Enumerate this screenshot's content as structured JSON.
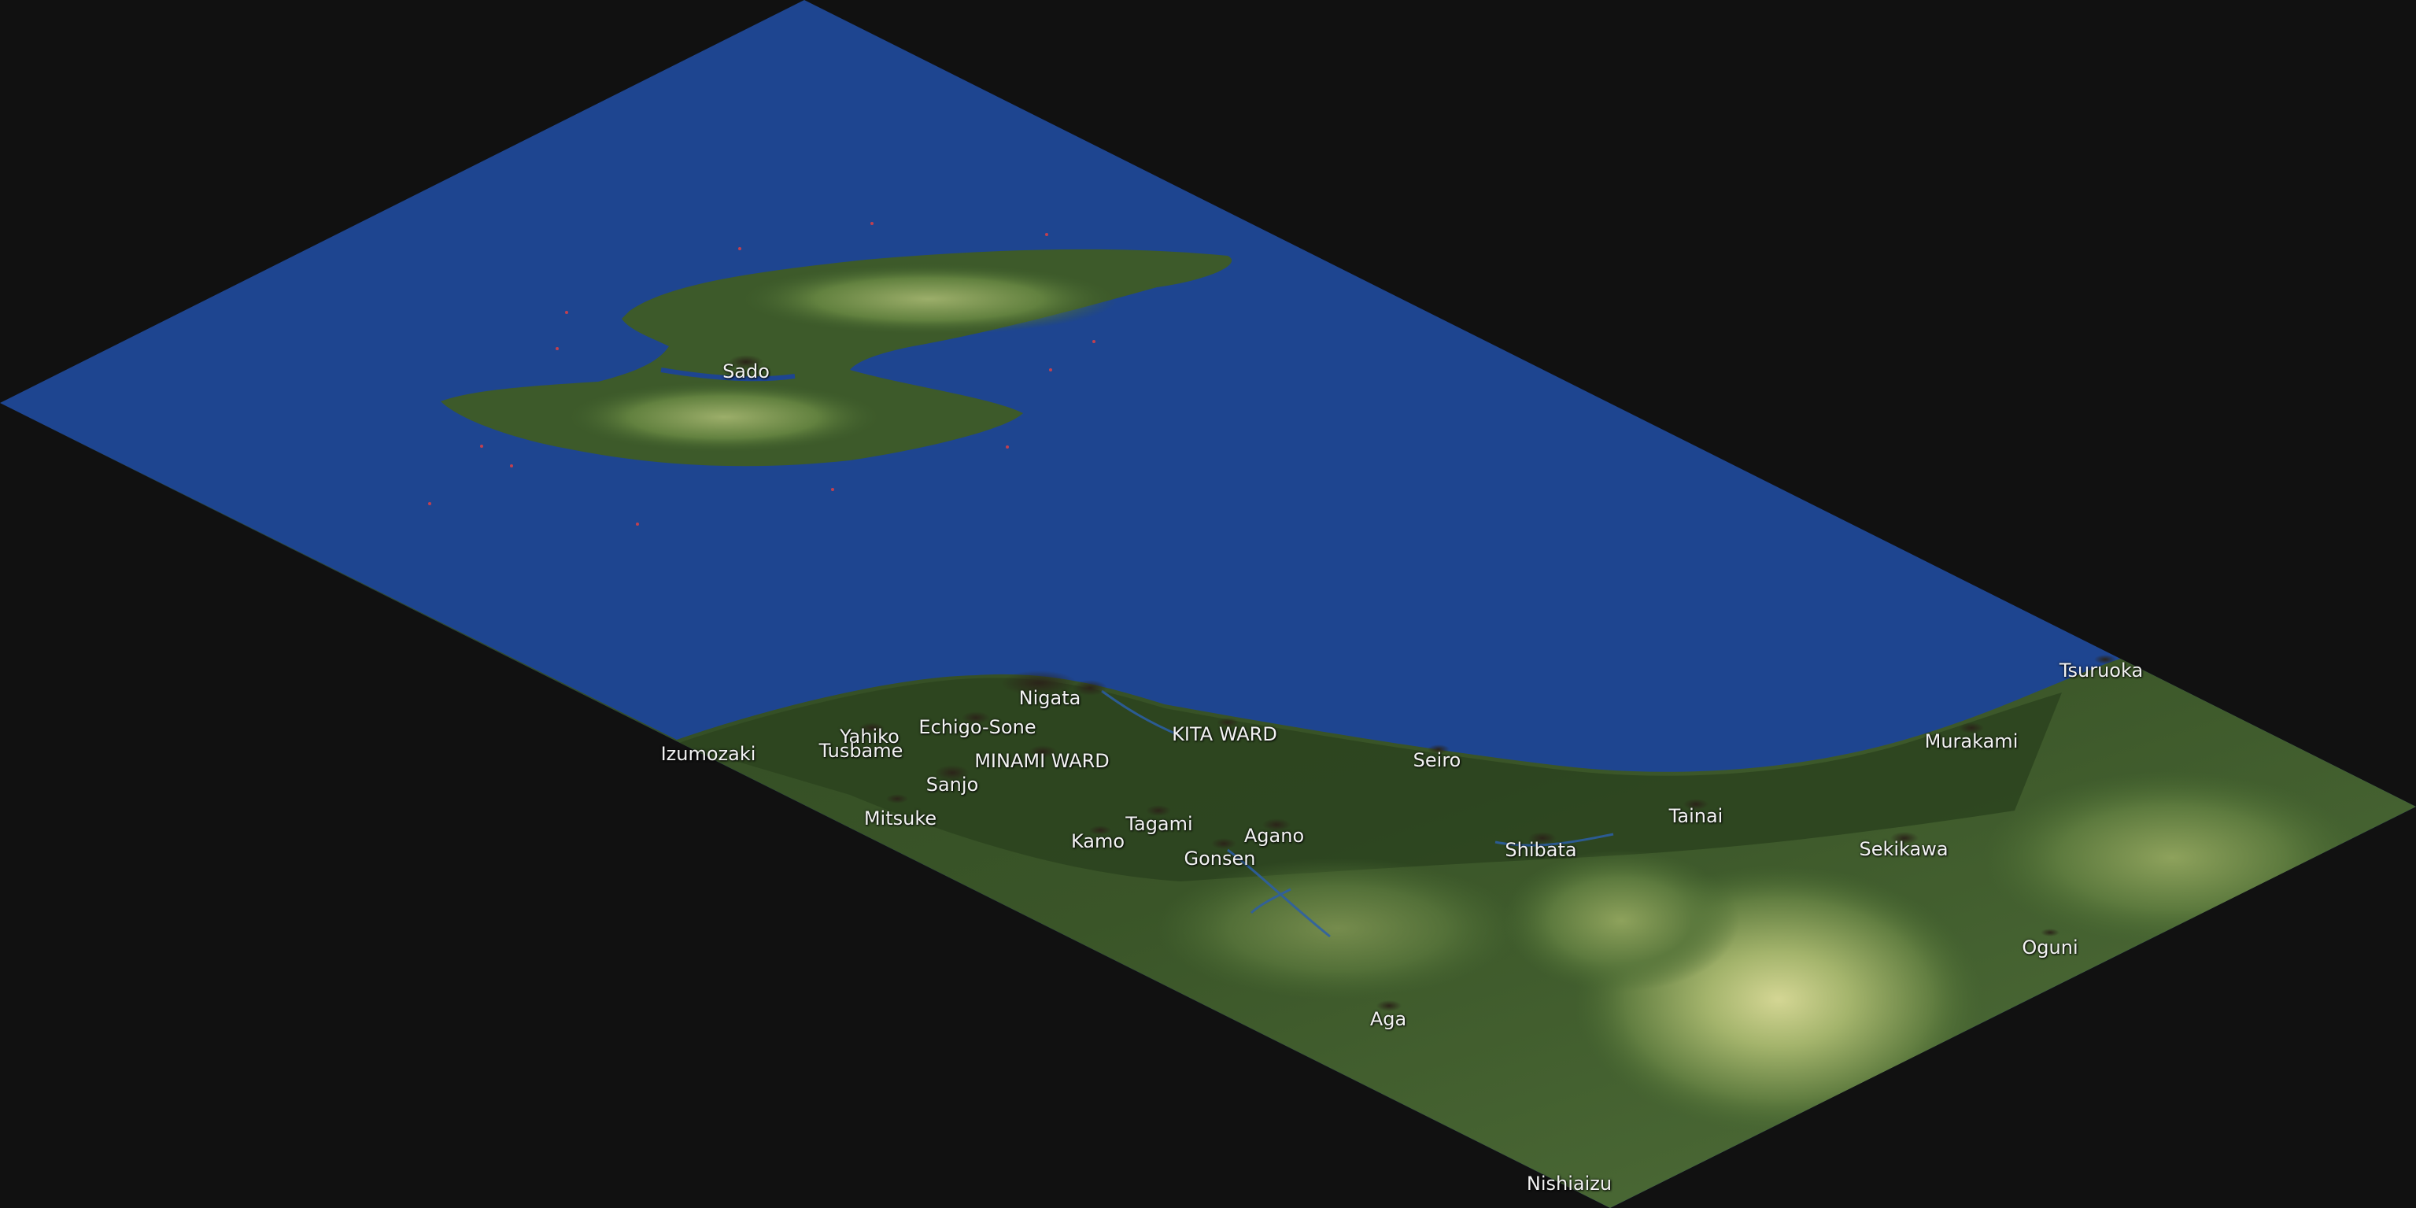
{
  "map": {
    "colors": {
      "background": "#111111",
      "water": "#1e4590",
      "land_low": "#2f4a22",
      "land_mid": "#4b6a32",
      "land_high": "#b9c47e",
      "town": "#2a2418"
    }
  },
  "towns": [
    {
      "id": "sado",
      "name": "Sado"
    },
    {
      "id": "nigata",
      "name": "Nigata"
    },
    {
      "id": "echigo-sone",
      "name": "Echigo-Sone"
    },
    {
      "id": "yahiko",
      "name": "Yahiko"
    },
    {
      "id": "tusbame",
      "name": "Tusbame"
    },
    {
      "id": "izumozaki",
      "name": "Izumozaki"
    },
    {
      "id": "minami-ward",
      "name": "MINAMI WARD"
    },
    {
      "id": "kita-ward",
      "name": "KITA WARD"
    },
    {
      "id": "sanjo",
      "name": "Sanjo"
    },
    {
      "id": "mitsuke",
      "name": "Mitsuke"
    },
    {
      "id": "kamo",
      "name": "Kamo"
    },
    {
      "id": "tagami",
      "name": "Tagami"
    },
    {
      "id": "agano",
      "name": "Agano"
    },
    {
      "id": "gonsen",
      "name": "Gonsen"
    },
    {
      "id": "seiro",
      "name": "Seiro"
    },
    {
      "id": "shibata",
      "name": "Shibata"
    },
    {
      "id": "tainai",
      "name": "Tainai"
    },
    {
      "id": "murakami",
      "name": "Murakami"
    },
    {
      "id": "tsuruoka",
      "name": "Tsuruoka"
    },
    {
      "id": "sekikawa",
      "name": "Sekikawa"
    },
    {
      "id": "oguni",
      "name": "Oguni"
    },
    {
      "id": "aga",
      "name": "Aga"
    },
    {
      "id": "nishiaizu",
      "name": "Nishiaizu"
    }
  ]
}
